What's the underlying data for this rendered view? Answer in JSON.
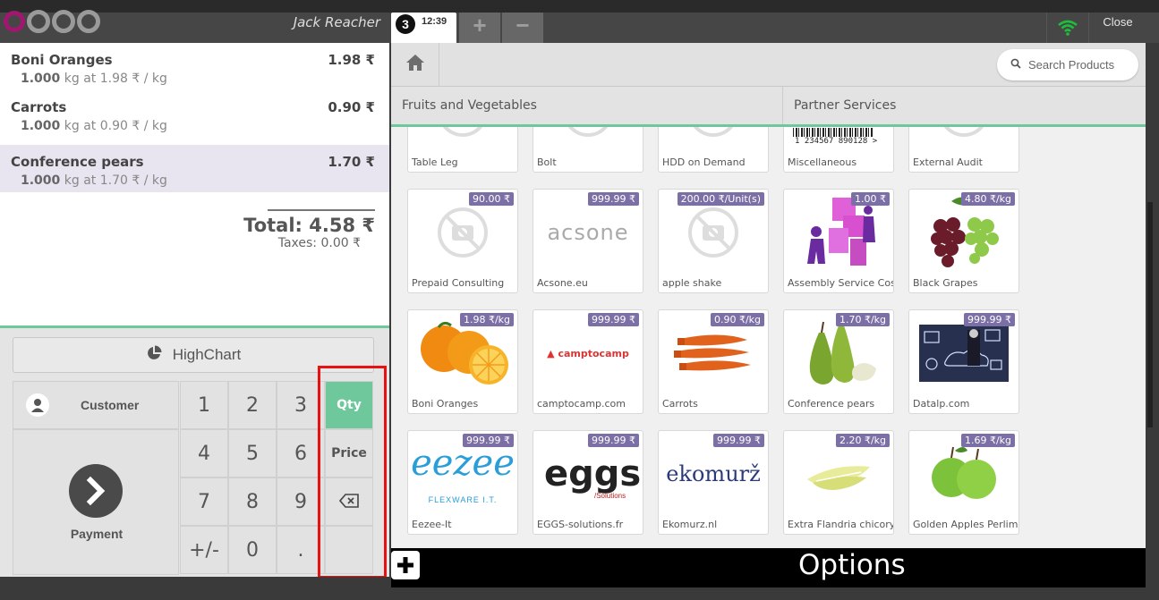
{
  "header": {
    "cashier": "Jack Reacher",
    "order_number": "3",
    "order_time": "12:39",
    "add_order_label": "+",
    "remove_order_label": "−",
    "close_label": "Close",
    "wifi_icon": "wifi-icon",
    "wifi_color": "#1dbf3a"
  },
  "order": {
    "lines": [
      {
        "name": "Boni Oranges",
        "price": "1.98 ₹",
        "qty": "1.000",
        "detail": "kg at 1.98 ₹ / kg",
        "selected": false
      },
      {
        "name": "Carrots",
        "price": "0.90 ₹",
        "qty": "1.000",
        "detail": "kg at 0.90 ₹ / kg",
        "selected": false
      },
      {
        "name": "Conference pears",
        "price": "1.70 ₹",
        "qty": "1.000",
        "detail": "kg at 1.70 ₹ / kg",
        "selected": true
      }
    ],
    "total": "Total: 4.58 ₹",
    "taxes": "Taxes: 0.00 ₹"
  },
  "pad": {
    "highchart_label": "HighChart",
    "customer_label": "Customer",
    "payment_label": "Payment",
    "keys": [
      "1",
      "2",
      "3",
      "4",
      "5",
      "6",
      "7",
      "8",
      "9",
      "+/-",
      "0",
      "."
    ],
    "modes": {
      "qty": "Qty",
      "price": "Price",
      "active": "Qty"
    },
    "backspace_icon": "backspace-icon",
    "accent_color": "#6ec89b"
  },
  "products_header": {
    "home_icon": "home-icon",
    "search_placeholder": "Search Products",
    "categories": [
      "Fruits and Vegetables",
      "Partner Services"
    ]
  },
  "products": [
    {
      "name": "Table Leg",
      "price": ""
    },
    {
      "name": "Bolt",
      "price": ""
    },
    {
      "name": "HDD on Demand",
      "price": ""
    },
    {
      "name": "Miscellaneous",
      "price": "",
      "barcode": "1 234567 890128 >"
    },
    {
      "name": "External Audit",
      "price": ""
    },
    {
      "name": "Prepaid Consulting",
      "price": "90.00 ₹"
    },
    {
      "name": "Acsone.eu",
      "price": "999.99 ₹",
      "logo_text": "acsone"
    },
    {
      "name": "apple shake",
      "price": "200.00 ₹/Unit(s)"
    },
    {
      "name": "Assembly Service Cost",
      "price": "1.00 ₹"
    },
    {
      "name": "Black Grapes",
      "price": "4.80 ₹/kg"
    },
    {
      "name": "Boni Oranges",
      "price": "1.98 ₹/kg"
    },
    {
      "name": "camptocamp.com",
      "price": "999.99 ₹",
      "logo_text": "camptocamp"
    },
    {
      "name": "Carrots",
      "price": "0.90 ₹/kg"
    },
    {
      "name": "Conference pears",
      "price": "1.70 ₹/kg"
    },
    {
      "name": "Datalp.com",
      "price": "999.99 ₹"
    },
    {
      "name": "Eezee-It",
      "price": "999.99 ₹",
      "logo_text": "eezee",
      "logo_sub": "FLEXWARE I.T."
    },
    {
      "name": "EGGS-solutions.fr",
      "price": "999.99 ₹",
      "logo_text": "eggs",
      "logo_sub": "/Solutions"
    },
    {
      "name": "Ekomurz.nl",
      "price": "999.99 ₹",
      "logo_text": "ekomurž"
    },
    {
      "name": "Extra Flandria chicory",
      "price": "2.20 ₹/kg"
    },
    {
      "name": "Golden Apples Perlim",
      "price": "1.69 ₹/kg"
    }
  ],
  "options": {
    "label": "Options",
    "plus_icon": "plus-icon"
  },
  "highlight_color": "#e81010"
}
